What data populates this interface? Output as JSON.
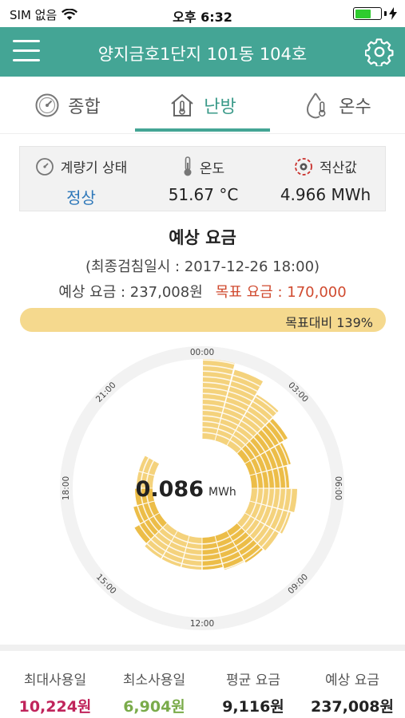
{
  "status": {
    "carrier": "SIM 없음",
    "time": "오후 6:32"
  },
  "header": {
    "title": "양지금호1단지 101동 104호"
  },
  "tabs": [
    {
      "label": "종합",
      "icon": "gauge-icon"
    },
    {
      "label": "난방",
      "icon": "house-thermometer-icon"
    },
    {
      "label": "온수",
      "icon": "drop-thermometer-icon"
    }
  ],
  "info": {
    "meter": {
      "label": "계량기 상태",
      "value": "정상"
    },
    "temperature": {
      "label": "온도",
      "value": "51.67 °C"
    },
    "cumulative": {
      "label": "적산값",
      "value": "4.966 MWh"
    }
  },
  "estimate": {
    "title": "예상 요금",
    "reading_date": "(최종검침일시 : 2017-12-26 18:00)",
    "expected_fee": "예상 요금 : 237,008원",
    "target_fee": "목표 요금 : 170,000",
    "target_ratio_text": "목표대비 139%",
    "target_ratio": 1.39
  },
  "chart_data": {
    "type": "radial-bar",
    "center_value": "0.086",
    "center_unit": "MWh",
    "hour_labels": [
      "00:00",
      "03:00",
      "06:00",
      "09:00",
      "12:00",
      "15:00",
      "18:00",
      "21:00"
    ],
    "hours": [
      0,
      1,
      2,
      3,
      4,
      5,
      6,
      7,
      8,
      9,
      10,
      11,
      12,
      13,
      14,
      15,
      16,
      17,
      18,
      19,
      20,
      21,
      22,
      23
    ],
    "values": [
      1.0,
      0.92,
      0.74,
      0.62,
      0.53,
      0.47,
      0.57,
      0.53,
      0.49,
      0.46,
      0.44,
      0.4,
      0.4,
      0.4,
      0.4,
      0.36,
      0.27,
      0.22,
      0.2,
      0.2,
      0.0,
      0.0,
      0.0,
      0.0
    ],
    "colors": {
      "light": "#f4d27c",
      "dark": "#ecbd48",
      "track": "#f2f2f2"
    }
  },
  "summary": [
    {
      "label": "최대사용일",
      "value": "10,224원"
    },
    {
      "label": "최소사용일",
      "value": "6,904원"
    },
    {
      "label": "평균 요금",
      "value": "9,116원"
    },
    {
      "label": "예상 요금",
      "value": "237,008원"
    }
  ]
}
